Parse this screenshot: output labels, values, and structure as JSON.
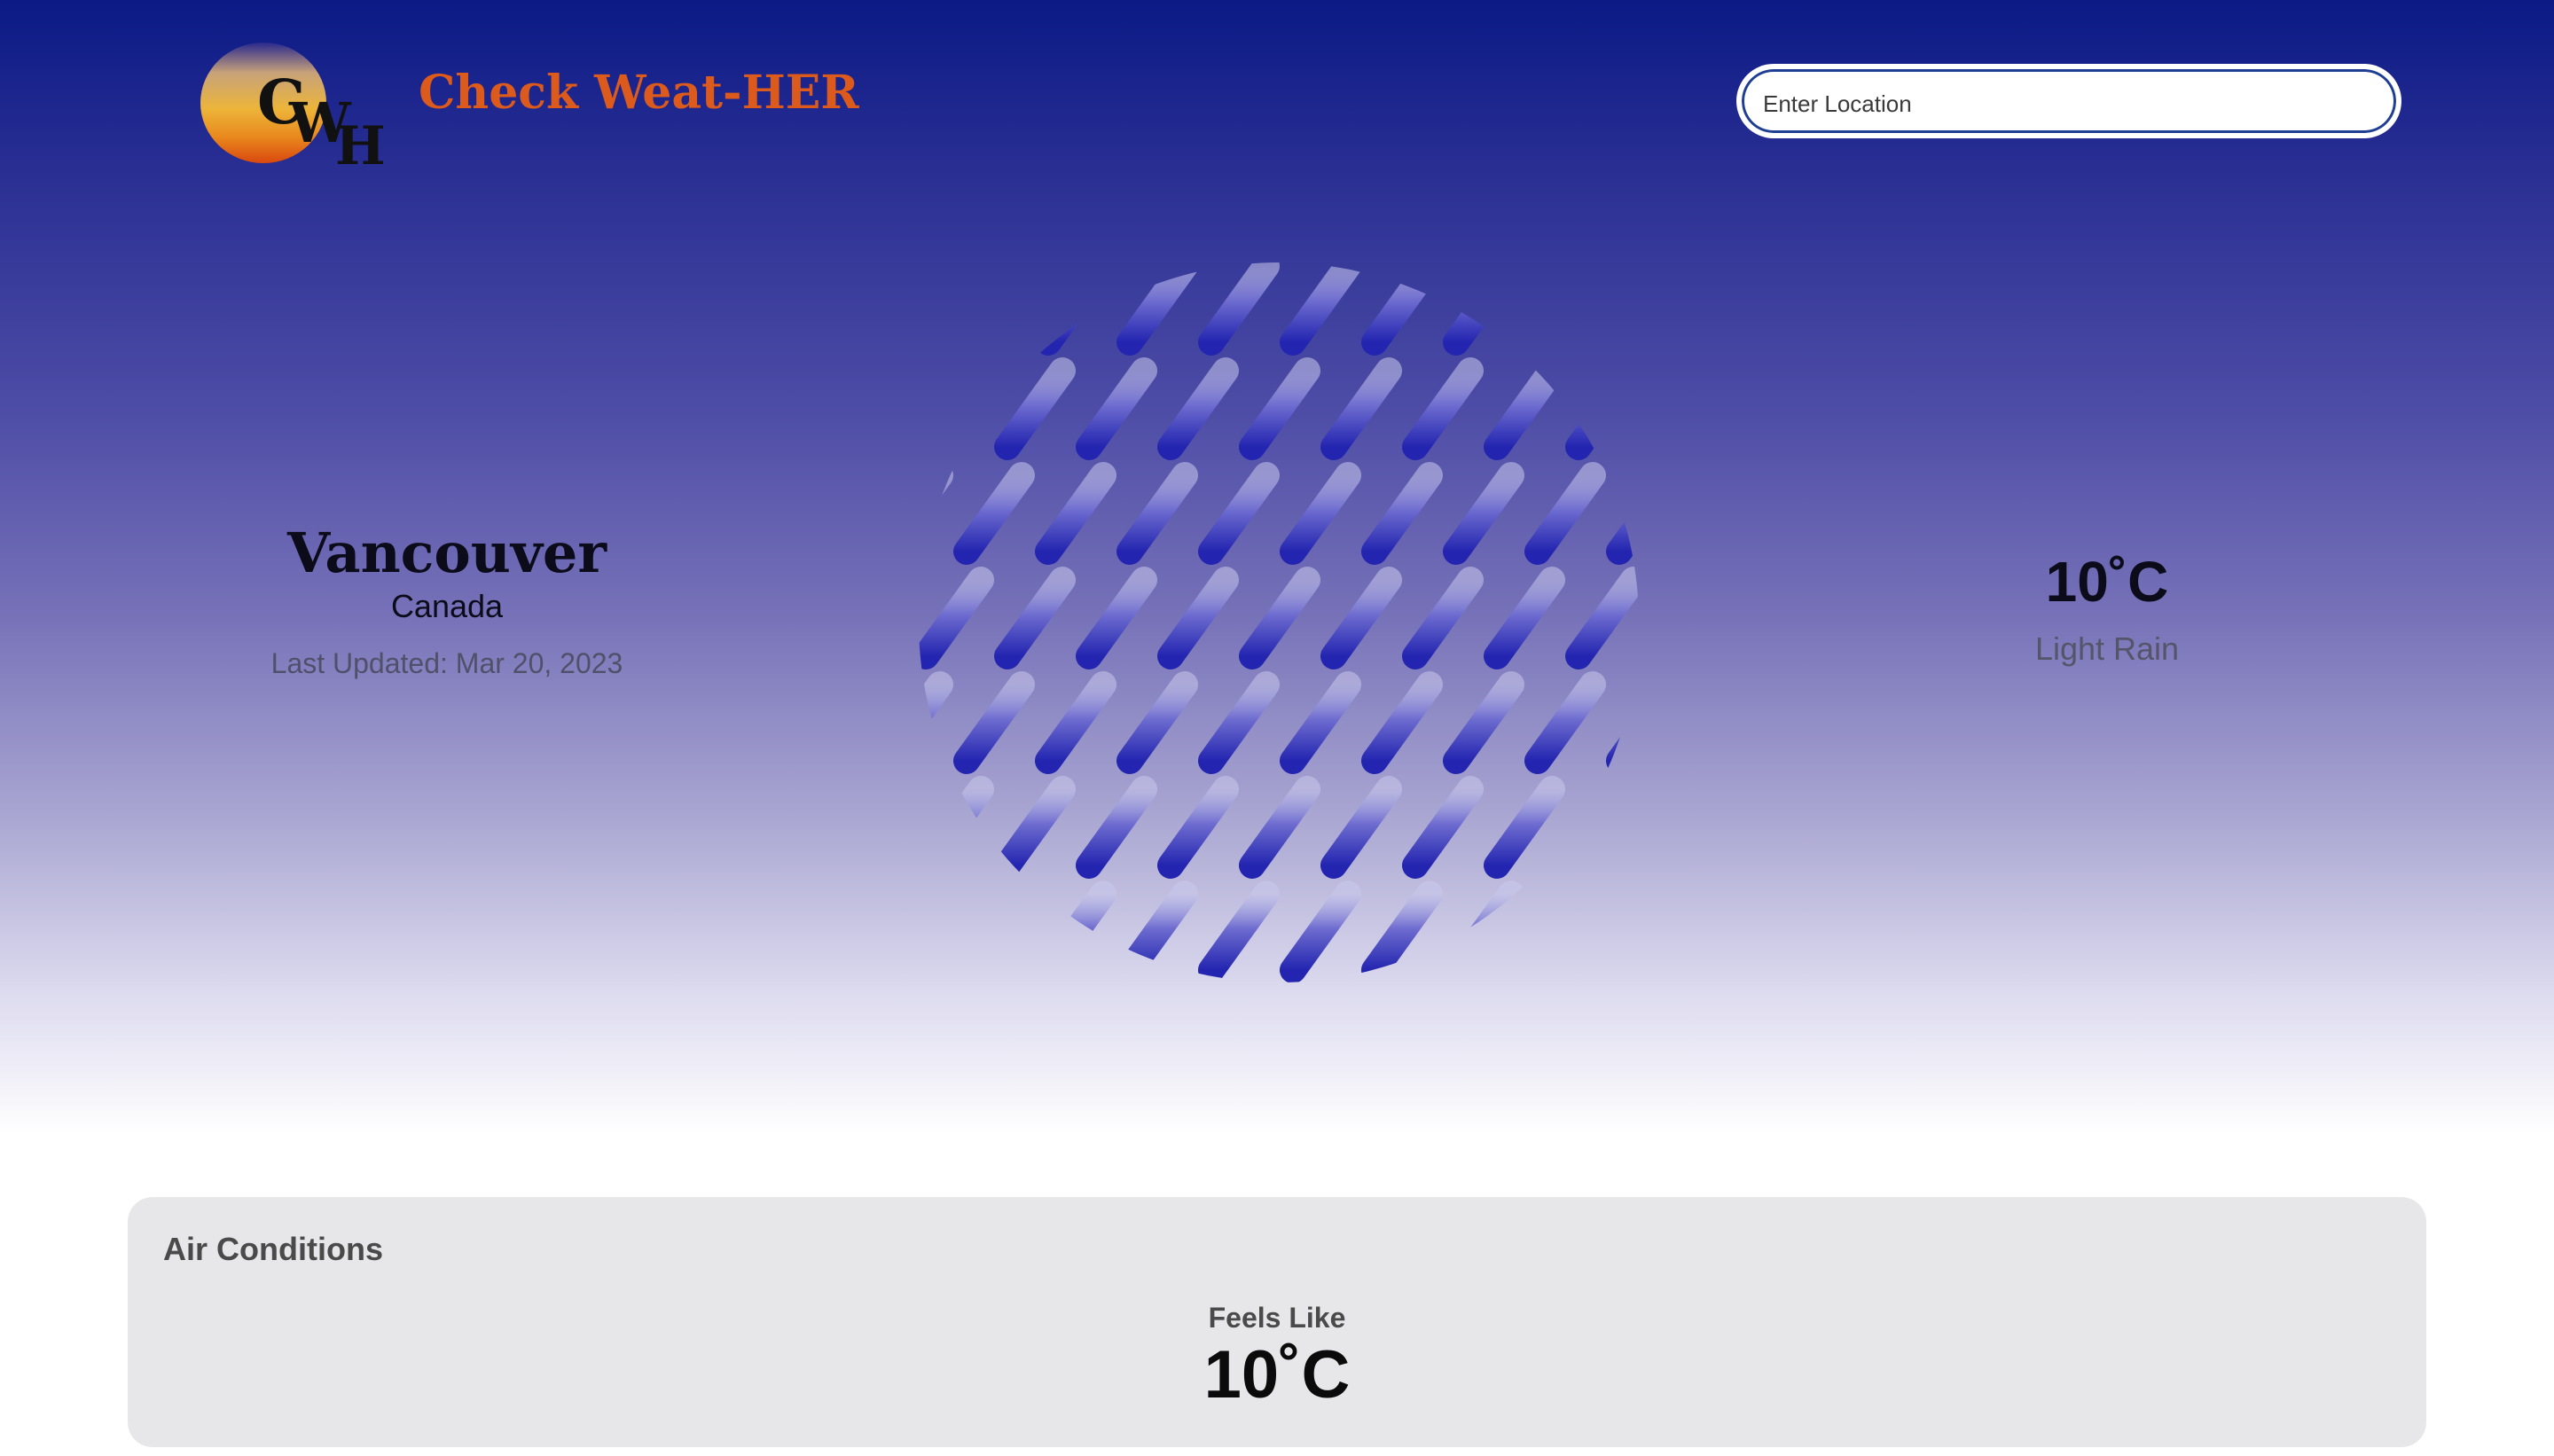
{
  "header": {
    "logo": {
      "letters": [
        "C",
        "W",
        "H"
      ]
    },
    "app_title": "Check Weat-HER",
    "search": {
      "placeholder": "Enter Location",
      "value": ""
    }
  },
  "location": {
    "city": "Vancouver",
    "country": "Canada",
    "last_updated": "Last Updated: Mar 20, 2023"
  },
  "weather": {
    "icon": "rain-icon",
    "temperature": "10˚C",
    "condition": "Light Rain"
  },
  "air_conditions": {
    "title": "Air Conditions",
    "feels_like_label": "Feels Like",
    "feels_like_value": "10˚C"
  },
  "colors": {
    "title_orange": "#dc5a1c",
    "rain_blue": "#2a2bb0",
    "card_bg": "#e7e7ea"
  }
}
